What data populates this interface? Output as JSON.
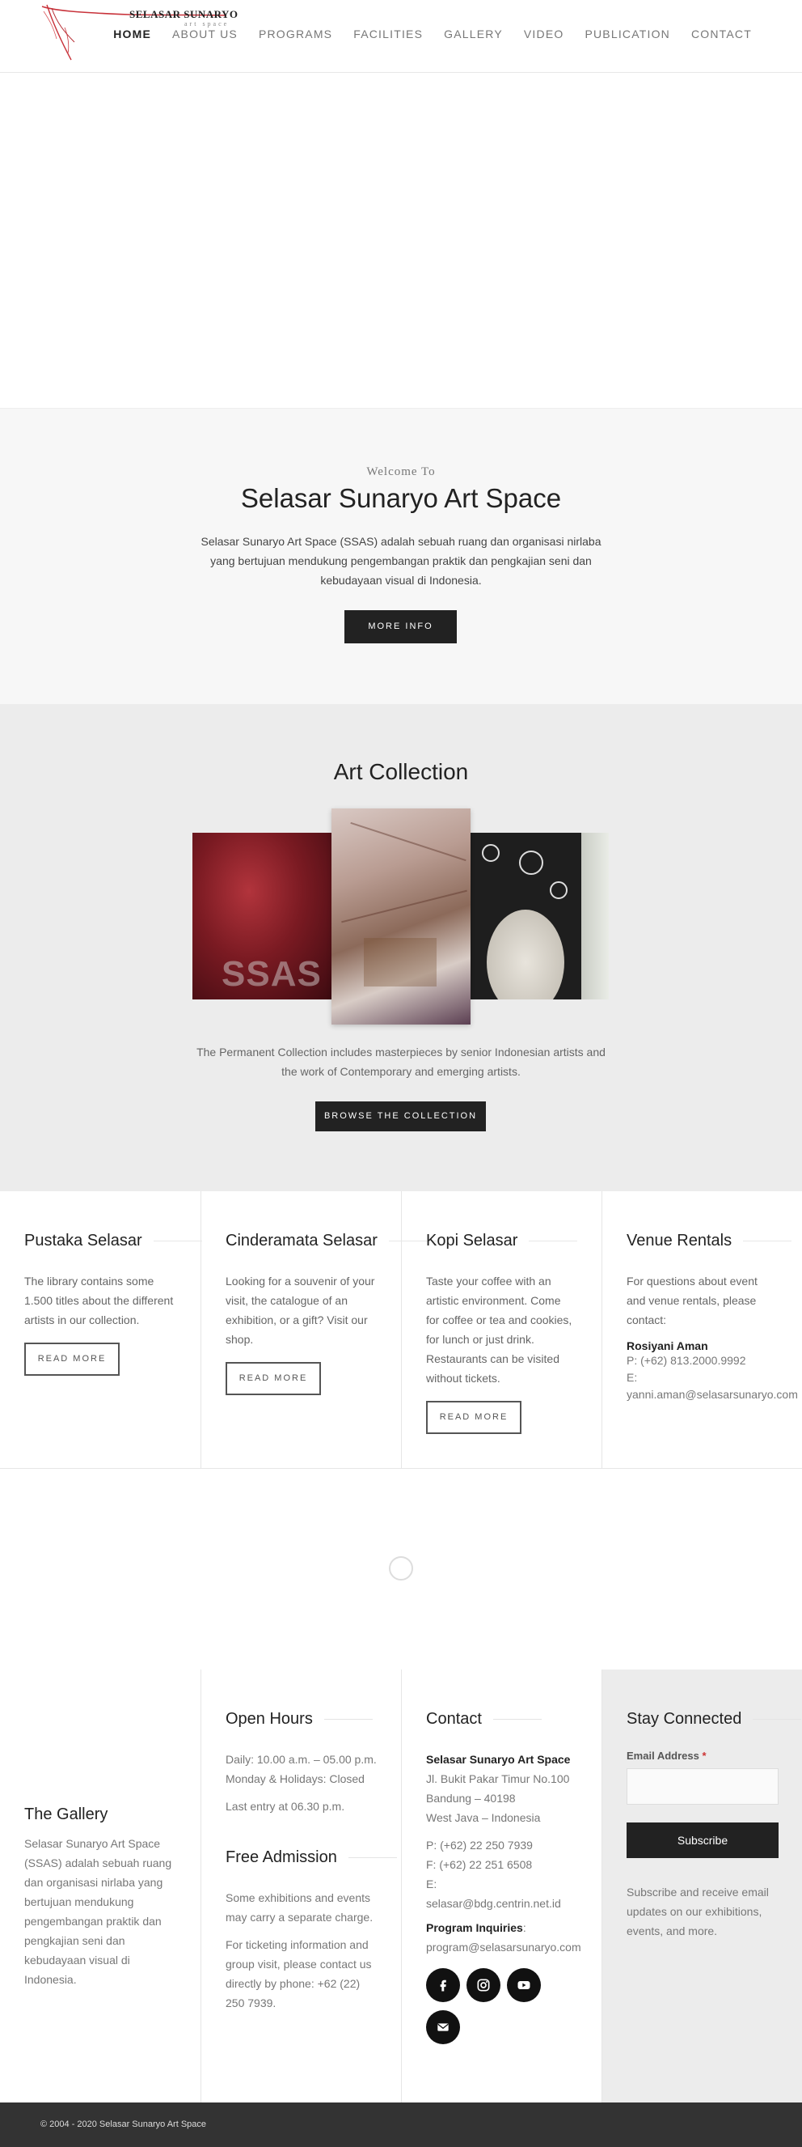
{
  "header": {
    "logo_title": "SELASAR SUNARYO",
    "logo_sub": "art space",
    "nav": [
      {
        "label": "HOME",
        "active": true
      },
      {
        "label": "ABOUT US"
      },
      {
        "label": "PROGRAMS"
      },
      {
        "label": "FACILITIES"
      },
      {
        "label": "GALLERY"
      },
      {
        "label": "VIDEO"
      },
      {
        "label": "PUBLICATION"
      },
      {
        "label": "CONTACT"
      }
    ]
  },
  "welcome": {
    "pre": "Welcome To",
    "title": "Selasar Sunaryo Art Space",
    "description": "Selasar Sunaryo Art Space (SSAS) adalah sebuah ruang dan organisasi nirlaba yang bertujuan mendukung pengembangan praktik dan pengkajian seni dan kebudayaan visual di Indonesia.",
    "button": "MORE INFO"
  },
  "collection": {
    "title": "Art Collection",
    "artwork_text": "SSAS",
    "description": "The Permanent Collection includes masterpieces by senior Indonesian artists and the work of Contemporary and emerging artists.",
    "button": "BROWSE THE COLLECTION"
  },
  "features": {
    "pustaka": {
      "title": "Pustaka Selasar",
      "text": "The library contains some 1.500 titles about the different artists in our collection.",
      "button": "READ MORE"
    },
    "cinderamata": {
      "title": "Cinderamata Selasar",
      "text": "Looking for a souvenir of your visit, the catalogue of an exhibition, or a gift? Visit our shop.",
      "button": "READ MORE"
    },
    "kopi": {
      "title": "Kopi Selasar",
      "text": "Taste your coffee with an artistic environment. Come for coffee or tea and cookies, for lunch or just drink. Restaurants can be visited without tickets.",
      "button": "READ MORE"
    },
    "venue": {
      "title": "Venue Rentals",
      "text": "For questions about event and venue rentals, please contact:",
      "name": "Rosiyani Aman",
      "phone": "P: (+62) 813.2000.9992",
      "email_label": "E:",
      "email": "yanni.aman@selasarsunaryo.com"
    }
  },
  "footer": {
    "gallery": {
      "title": "The Gallery",
      "text": "Selasar Sunaryo Art Space (SSAS) adalah sebuah ruang dan organisasi nirlaba yang bertujuan mendukung pengembangan praktik dan pengkajian seni dan kebudayaan visual di Indonesia."
    },
    "hours": {
      "title": "Open Hours",
      "daily": "Daily: 10.00 a.m. – 05.00 p.m.",
      "closed": "Monday & Holidays: Closed",
      "last_entry": "Last entry at 06.30 p.m."
    },
    "admission": {
      "title": "Free Admission",
      "text1": "Some exhibitions and events may carry a separate charge.",
      "text2": "For ticketing information and group visit, please contact us directly by phone: +62 (22) 250 7939."
    },
    "contact": {
      "title": "Contact",
      "org": "Selasar Sunaryo Art Space",
      "address1": "Jl. Bukit Pakar Timur No.100",
      "address2": "Bandung – 40198",
      "address3": "West Java – Indonesia",
      "phone": "P: (+62) 22 250 7939",
      "fax": "F: (+62) 22 251 6508",
      "email_label": "E:",
      "email": "selasar@bdg.centrin.net.id",
      "program_label": "Program Inquiries",
      "program_colon": ":",
      "program_email": "program@selasarsunaryo.com"
    },
    "social": [
      {
        "icon": "facebook-icon"
      },
      {
        "icon": "instagram-icon"
      },
      {
        "icon": "youtube-icon"
      },
      {
        "icon": "mail-icon"
      }
    ],
    "stay": {
      "title": "Stay Connected",
      "email_label": "Email Address",
      "required_mark": "*",
      "placeholder": "",
      "button": "Subscribe",
      "text": "Subscribe and receive email updates on our exhibitions, events, and more."
    }
  },
  "copyright": "© 2004 - 2020 Selasar Sunaryo Art Space",
  "colors": {
    "accent_red": "#c8323a",
    "dark": "#222222",
    "light_bg": "#f7f7f7",
    "grey_bg": "#ececec",
    "footer_bar": "#333333"
  }
}
